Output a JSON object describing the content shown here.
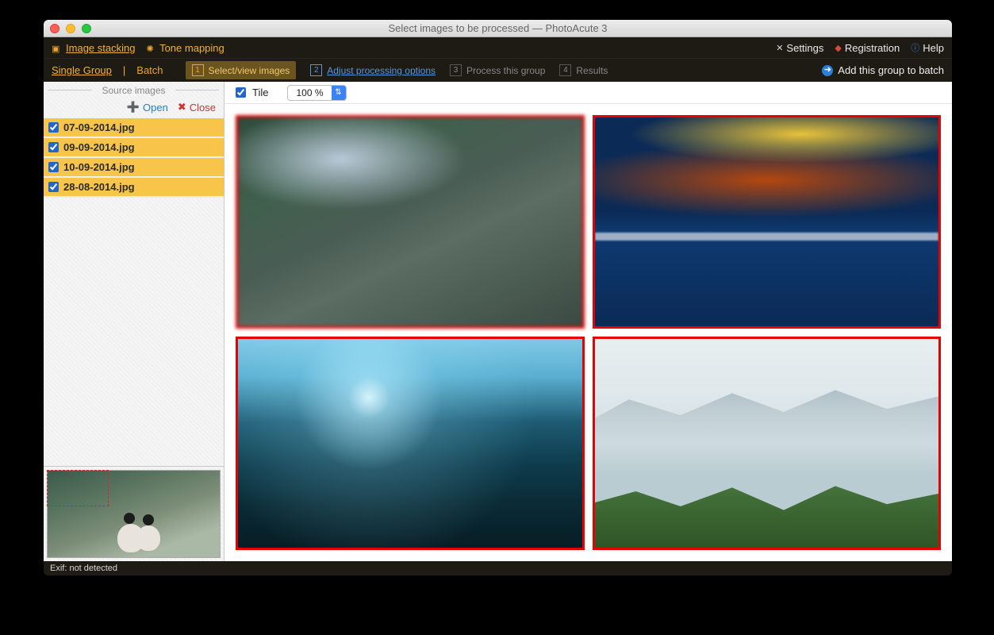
{
  "window": {
    "title": "Select images to be processed — PhotoAcute 3"
  },
  "modebar": {
    "image_stacking": "Image stacking",
    "tone_mapping": "Tone mapping",
    "settings": "Settings",
    "registration": "Registration",
    "help": "Help"
  },
  "stepbar": {
    "single_group": "Single Group",
    "batch": "Batch",
    "steps": [
      {
        "num": "1",
        "label": "Select/view images",
        "state": "active"
      },
      {
        "num": "2",
        "label": "Adjust processing options",
        "state": "link"
      },
      {
        "num": "3",
        "label": "Process this group",
        "state": "disabled"
      },
      {
        "num": "4",
        "label": "Results",
        "state": "disabled"
      }
    ],
    "add_group": "Add this group to batch"
  },
  "sidebar": {
    "header": "Source images",
    "open": "Open",
    "close": "Close",
    "files": [
      "07-09-2014.jpg",
      "09-09-2014.jpg",
      "10-09-2014.jpg",
      "28-08-2014.jpg"
    ]
  },
  "content": {
    "tile_label": "Tile",
    "tile_checked": true,
    "zoom": "100 %"
  },
  "status": {
    "exif": "Exif: not detected"
  }
}
